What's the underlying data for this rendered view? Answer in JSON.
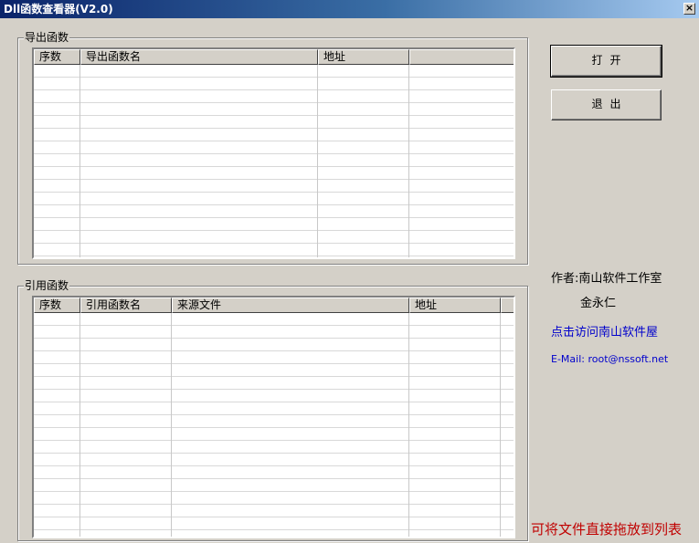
{
  "window": {
    "title": "Dll函数查看器(V2.0)",
    "close_label": "×"
  },
  "export_group": {
    "label": "导出函数",
    "columns": [
      "序数",
      "导出函数名",
      "地址",
      ""
    ]
  },
  "import_group": {
    "label": "引用函数",
    "columns": [
      "序数",
      "引用函数名",
      "来源文件",
      "地址",
      ""
    ]
  },
  "buttons": {
    "open": "打开",
    "exit": "退出"
  },
  "info": {
    "author_line": "作者:南山软件工作室",
    "author_name": "金永仁",
    "visit_link": "点击访问南山软件屋",
    "email": "E-Mail: root@nssoft.net",
    "hint": "可将文件直接拖放到列表"
  },
  "colors": {
    "link": "#0000cc",
    "hint": "#c00000"
  }
}
